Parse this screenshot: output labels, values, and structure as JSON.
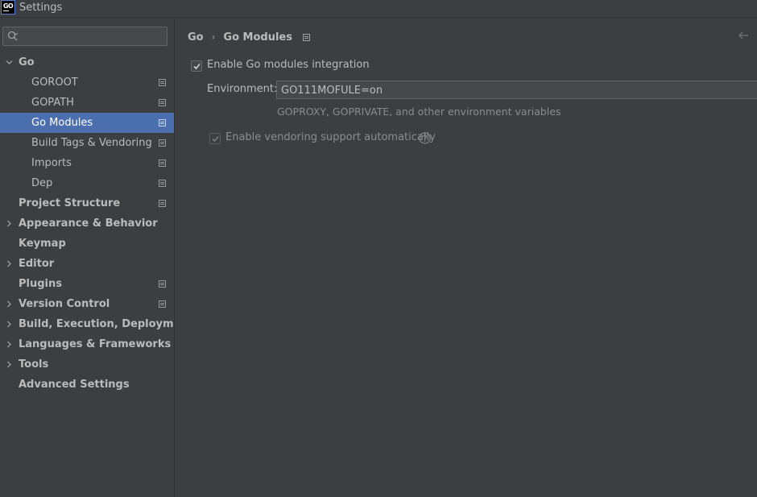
{
  "window": {
    "title": "Settings",
    "logo_text": "GO"
  },
  "search": {
    "value": "",
    "placeholder": ""
  },
  "sidebar": {
    "items": [
      {
        "label": "Go",
        "level": 0,
        "expandable": true,
        "expanded": true,
        "project_icon": false
      },
      {
        "label": "GOROOT",
        "level": 1,
        "project_icon": true
      },
      {
        "label": "GOPATH",
        "level": 1,
        "project_icon": true
      },
      {
        "label": "Go Modules",
        "level": 1,
        "project_icon": true,
        "selected": true
      },
      {
        "label": "Build Tags & Vendoring",
        "level": 1,
        "project_icon": true
      },
      {
        "label": "Imports",
        "level": 1,
        "project_icon": true
      },
      {
        "label": "Dep",
        "level": 1,
        "project_icon": true
      },
      {
        "label": "Project Structure",
        "level": 0,
        "expandable": false,
        "project_icon": true
      },
      {
        "label": "Appearance & Behavior",
        "level": 0,
        "expandable": true,
        "project_icon": false
      },
      {
        "label": "Keymap",
        "level": 0,
        "expandable": false,
        "project_icon": false
      },
      {
        "label": "Editor",
        "level": 0,
        "expandable": true,
        "project_icon": false
      },
      {
        "label": "Plugins",
        "level": 0,
        "expandable": false,
        "project_icon": true
      },
      {
        "label": "Version Control",
        "level": 0,
        "expandable": true,
        "project_icon": true
      },
      {
        "label": "Build, Execution, Deployment",
        "level": 0,
        "expandable": true,
        "project_icon": false
      },
      {
        "label": "Languages & Frameworks",
        "level": 0,
        "expandable": true,
        "project_icon": false
      },
      {
        "label": "Tools",
        "level": 0,
        "expandable": true,
        "project_icon": false
      },
      {
        "label": "Advanced Settings",
        "level": 0,
        "expandable": false,
        "project_icon": false
      }
    ]
  },
  "breadcrumb": {
    "parent": "Go",
    "separator": "›",
    "current": "Go Modules"
  },
  "main": {
    "enable_modules": {
      "label": "Enable Go modules integration",
      "checked": true
    },
    "environment": {
      "label": "Environment:",
      "value": "GO111MOFULE=on",
      "hint": "GOPROXY, GOPRIVATE, and other environment variables"
    },
    "vendoring": {
      "label": "Enable vendoring support automatically",
      "checked": true,
      "disabled": true
    }
  },
  "colors": {
    "background": "#3c3f41",
    "selection": "#4b6eaf",
    "text": "#bbbbbb",
    "hint": "#8c8c8c"
  }
}
